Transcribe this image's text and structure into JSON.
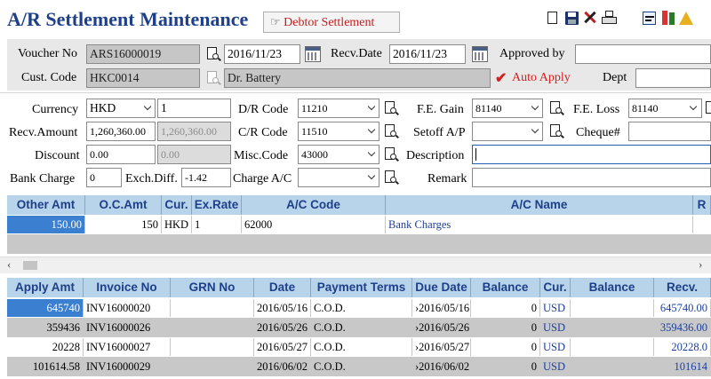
{
  "title": "A/R Settlement Maintenance",
  "debtor_button": "Debtor Settlement",
  "header": {
    "voucher_label": "Voucher No",
    "voucher_no": "ARS16000019",
    "voucher_date": "2016/11/23",
    "recv_date_label": "Recv.Date",
    "recv_date": "2016/11/23",
    "approved_label": "Approved by",
    "cust_label": "Cust. Code",
    "cust_code": "HKC0014",
    "cust_name": "Dr. Battery",
    "auto_apply": "Auto Apply",
    "dept_label": "Dept"
  },
  "form": {
    "currency_label": "Currency",
    "currency": "HKD",
    "rate": "1",
    "recv_amount_label": "Recv.Amount",
    "recv_amount": "1,260,360.00",
    "recv_amount2": "1,260,360.00",
    "discount_label": "Discount",
    "discount": "0.00",
    "discount2": "0.00",
    "bank_charge_label": "Bank Charge",
    "bank_charge": "0",
    "exch_diff_label": "Exch.Diff.",
    "exch_diff": "-1.42",
    "dr_code_label": "D/R Code",
    "dr_code": "11210",
    "cr_code_label": "C/R Code",
    "cr_code": "11510",
    "misc_code_label": "Misc.Code",
    "misc_code": "43000",
    "charge_ac_label": "Charge A/C",
    "charge_ac": "",
    "fe_gain_label": "F.E. Gain",
    "fe_gain": "81140",
    "fe_loss_label": "F.E. Loss",
    "fe_loss": "81140",
    "setoff_label": "Setoff A/P",
    "cheque_label": "Cheque#",
    "description_label": "Description",
    "remark_label": "Remark"
  },
  "other_grid": {
    "headers": [
      "Other Amt",
      "O.C.Amt",
      "Cur.",
      "Ex.Rate",
      "A/C Code",
      "A/C Name",
      "R"
    ],
    "rows": [
      [
        "150.00",
        "150",
        "HKD",
        "1",
        "62000",
        "Bank Charges",
        ""
      ]
    ]
  },
  "apply_grid": {
    "headers": [
      "Apply Amt",
      "Invoice No",
      "GRN No",
      "Date",
      "Payment Terms",
      "Due Date",
      "Balance",
      "Cur.",
      "Balance",
      "Recv."
    ],
    "rows": [
      [
        "645740",
        "INV16000020",
        "",
        "2016/05/16",
        "C.O.D.",
        "›2016/05/16‹",
        "0",
        "USD",
        "",
        "645740.00"
      ],
      [
        "359436",
        "INV16000026",
        "",
        "2016/05/26",
        "C.O.D.",
        "›2016/05/26‹",
        "0",
        "USD",
        "",
        "359436.00"
      ],
      [
        "20228",
        "INV16000027",
        "",
        "2016/05/27",
        "C.O.D.",
        "›2016/05/27‹",
        "0",
        "USD",
        "",
        "20228.0"
      ],
      [
        "101614.58",
        "INV16000029",
        "",
        "2016/06/02",
        "C.O.D.",
        "›2016/06/02‹",
        "0",
        "USD",
        "",
        "101614"
      ]
    ]
  },
  "colors": {
    "title": "#1e3f8a",
    "accent": "#d42020",
    "header_bg": "#b8d4ea",
    "selected": "#3b7fd0"
  }
}
